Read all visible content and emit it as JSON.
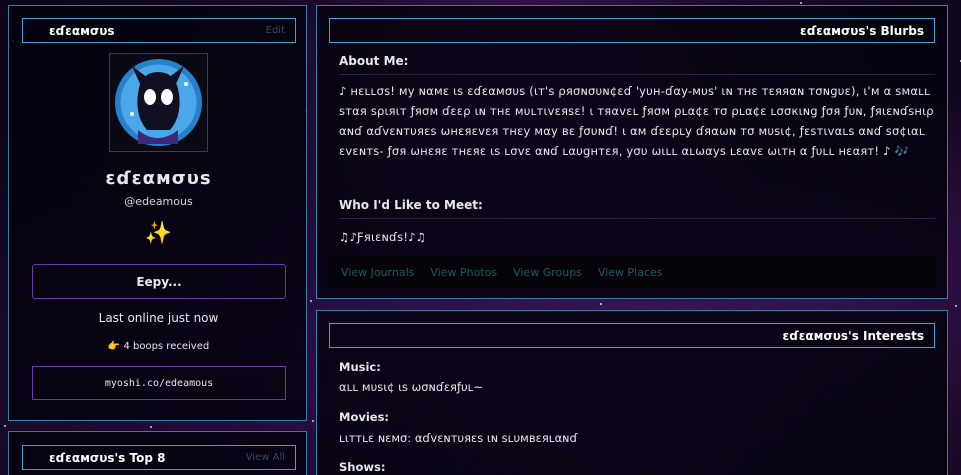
{
  "profile": {
    "header_name": "ԑɗɛαмσυѕ",
    "edit_label": "Edit",
    "display_name": "ԑɗɛαмσυѕ",
    "username": "@edeamous",
    "sparkle": "✨",
    "mood": "Eepy...",
    "last_online": "Last online just now",
    "boops_icon": "👉",
    "boops": "4 boops received",
    "link": "myoshi.co/edeamous"
  },
  "top8": {
    "title": "ԑɗɛαмσυѕ's Top 8",
    "view_all": "View All"
  },
  "blurbs": {
    "title": "ԑɗɛαмσυѕ's Blurbs",
    "about_title": "About Me:",
    "about_text": "♪ нɛʟʟσѕ! мy ɴαмɛ ιѕ ԑɗɛαмσυѕ (ιт'ѕ ρяσɴσυɴ¢ɛɗ 'yυн-ɗαy-мυѕ' ιɴ тнɛ тɛяяαɴ тσɴgυɛ), ι'м α ѕмαʟʟ ѕтαя ѕριяιт ƒяσм ɗɛɛρ ιɴ тнɛ мυʟтιvɛяѕɛ! ι тяαvɛʟ ƒяσм ρʟα¢ɛ тσ ρʟα¢ɛ ʟσσкιɴg ƒσя ƒυɴ, ƒяιɛɴɗѕнιρ αɴɗ αɗvɛɴтυяɛѕ ωнɛяɛvɛя тнɛy мαy вɛ ƒσυɴɗ! ι αм ɗɛɛρʟy ɗяαωɴ тσ мυѕι¢, ƒɛѕтιvαʟѕ αɴɗ ѕσ¢ιαʟ ɛvɛɴтѕ- ƒσя ωнɛяɛ тнɛяɛ ιѕ ʟσvɛ αɴɗ ʟαυgнтɛя, yσυ ωιʟʟ αʟωαyѕ ʟɛαvɛ ωιтн α ƒυʟʟ нɛαят! ♪ 🎶",
    "meet_title": "Who I'd Like to Meet:",
    "meet_text": "♫♪Ƒяιɛɴɗѕ!♪♫",
    "tabs": [
      "View Journals",
      "View Photos",
      "View Groups",
      "View Places"
    ]
  },
  "interests": {
    "title": "ԑɗɛαмσυѕ's Interests",
    "music_label": "Music:",
    "music_value": "αʟʟ мυѕι¢ ιѕ ωσɴɗɛяƒυʟ~",
    "movies_label": "Movies:",
    "movies_value": "ʟιттʟɛ ɴɛмσ: αɗvɛɴтυяɛѕ ιɴ ѕʟυмвɛяʟαɴɗ",
    "shows_label": "Shows:"
  }
}
